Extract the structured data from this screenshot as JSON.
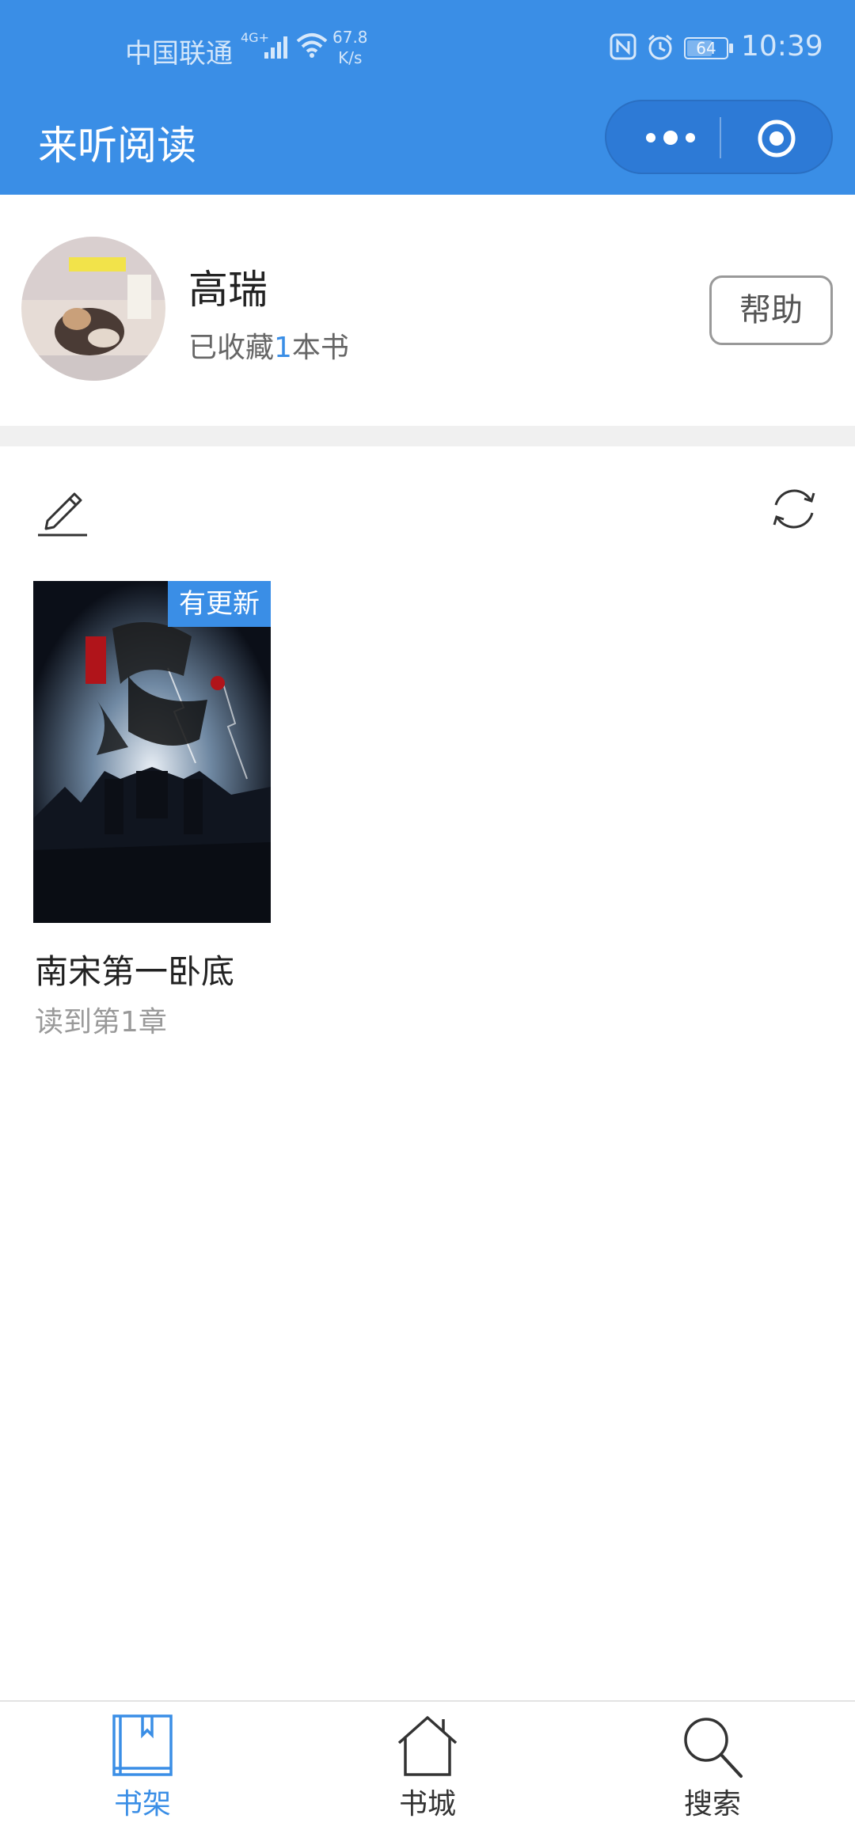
{
  "status_bar": {
    "carrier": "中国联通",
    "network_tag": "4G+",
    "speed_value": "67.8",
    "speed_unit": "K/s",
    "battery": "64",
    "time": "10:39"
  },
  "nav": {
    "title": "来听阅读",
    "capsule_icons": [
      "more-dots-icon",
      "target-icon"
    ]
  },
  "profile": {
    "username": "高瑞",
    "collected_prefix": "已收藏",
    "collected_count": "1",
    "collected_suffix": "本书",
    "help_label": "帮助"
  },
  "toolbar": {
    "icons": [
      "edit-icon",
      "refresh-icon"
    ]
  },
  "books": [
    {
      "title": "南宋第一卧底",
      "badge": "有更新",
      "progress": "读到第1章"
    }
  ],
  "tabs": [
    {
      "label": "书架",
      "icon": "bookshelf-icon",
      "active": true
    },
    {
      "label": "书城",
      "icon": "home-icon",
      "active": false
    },
    {
      "label": "搜索",
      "icon": "search-icon",
      "active": false
    }
  ],
  "colors": {
    "accent": "#3a8ee6",
    "background": "#ffffff",
    "separator": "#f0f0f0"
  }
}
